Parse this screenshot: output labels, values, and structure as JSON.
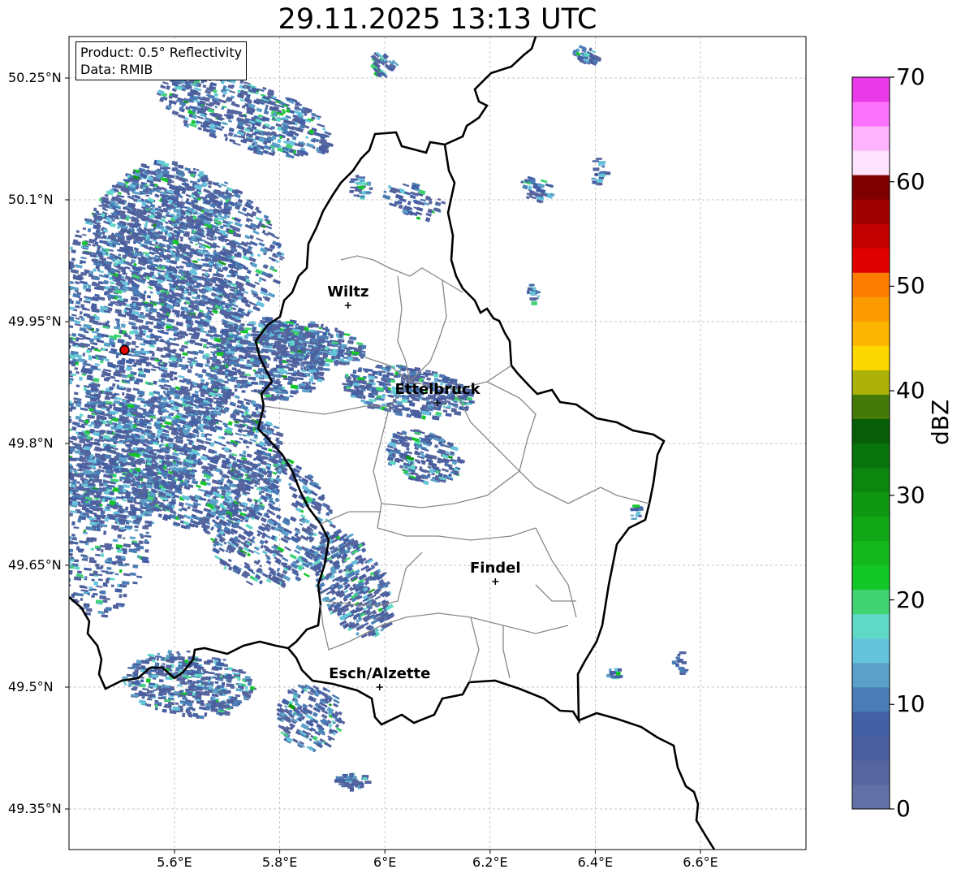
{
  "title": "29.11.2025 13:13 UTC",
  "info_box": {
    "product": "Product: 0.5° Reflectivity",
    "data": "Data: RMIB"
  },
  "y_ticks": [
    "50.25°N",
    "50.1°N",
    "49.95°N",
    "49.8°N",
    "49.65°N",
    "49.5°N",
    "49.35°N"
  ],
  "x_ticks": [
    "5.6°E",
    "5.8°E",
    "6°E",
    "6.2°E",
    "6.4°E",
    "6.6°E"
  ],
  "cities": [
    {
      "name": "Wiltz",
      "lon": 5.93,
      "lat": 49.97
    },
    {
      "name": "Ettelbruck",
      "lon": 6.1,
      "lat": 49.85
    },
    {
      "name": "Findel",
      "lon": 6.21,
      "lat": 49.63
    },
    {
      "name": "Esch/Alzette",
      "lon": 5.99,
      "lat": 49.5
    }
  ],
  "radar_site": {
    "lon": 5.505,
    "lat": 49.915,
    "color": "#e00000"
  },
  "colorbar": {
    "label": "dBZ",
    "ticks": [
      "0",
      "10",
      "20",
      "30",
      "40",
      "50",
      "60",
      "70"
    ],
    "min": 0,
    "max": 70,
    "colors": [
      "#6272a8",
      "#56659e",
      "#4b5e9e",
      "#4460a5",
      "#4a7db5",
      "#5aa0c8",
      "#66c3dc",
      "#5fd8c8",
      "#3fd373",
      "#14c728",
      "#12b81c",
      "#10a816",
      "#0f9712",
      "#0c860f",
      "#0a740c",
      "#085d09",
      "#457a0b",
      "#adb20a",
      "#fdd700",
      "#fcb500",
      "#fc9b00",
      "#fc7d00",
      "#e00000",
      "#c20000",
      "#a00000",
      "#7e0000",
      "#fde3fd",
      "#feb3fd",
      "#fd72fd",
      "#e93ae9"
    ]
  }
}
